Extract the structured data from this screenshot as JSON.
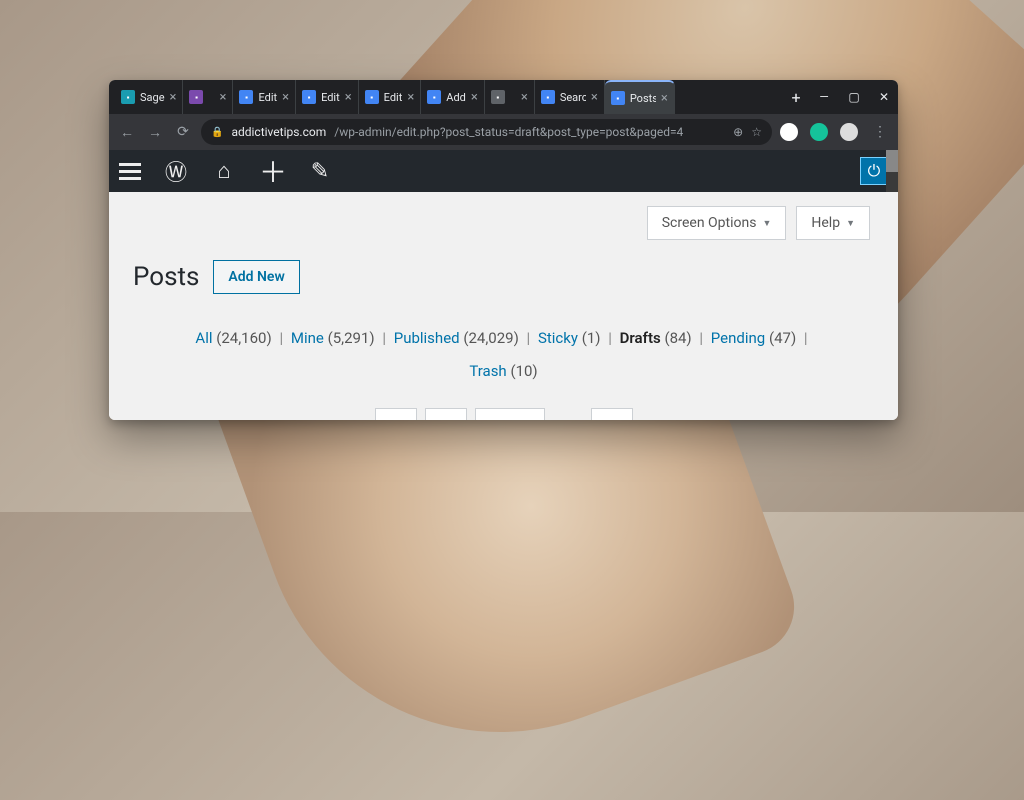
{
  "window": {
    "minimize": "—",
    "maximize": "▢",
    "close": "✕"
  },
  "tabs": [
    {
      "label": "Sage",
      "favicon": "fav-teal"
    },
    {
      "label": "",
      "favicon": "fav-purple"
    },
    {
      "label": "Edit",
      "favicon": "fav-blue"
    },
    {
      "label": "Edit",
      "favicon": "fav-blue"
    },
    {
      "label": "Edit",
      "favicon": "fav-blue"
    },
    {
      "label": "Add",
      "favicon": "fav-blue"
    },
    {
      "label": "",
      "favicon": "fav-grey"
    },
    {
      "label": "Searc",
      "favicon": "fav-blue"
    },
    {
      "label": "Posts",
      "favicon": "fav-blue",
      "active": true
    }
  ],
  "newtab": "+",
  "address": {
    "domain": "addictivetips.com",
    "path": "/wp-admin/edit.php?post_status=draft&post_type=post&paged=4"
  },
  "omni_icons": {
    "lock": "🔒",
    "reader": "⊕",
    "star": "☆"
  },
  "toolbar": {
    "back": "←",
    "forward": "→",
    "reload": "⟳"
  },
  "wordpress_bar": {
    "menu": "menu",
    "logo": "Ⓦ",
    "home": "⌂",
    "new": "＋",
    "edit": "✎",
    "power": "⏻"
  },
  "screen_options_label": "Screen Options",
  "help_label": "Help",
  "page_title": "Posts",
  "add_new_label": "Add New",
  "filters": {
    "all": {
      "label": "All",
      "count": "(24,160)"
    },
    "mine": {
      "label": "Mine",
      "count": "(5,291)"
    },
    "published": {
      "label": "Published",
      "count": "(24,029)"
    },
    "sticky": {
      "label": "Sticky",
      "count": "(1)"
    },
    "drafts": {
      "label": "Drafts",
      "count": "(84)"
    },
    "pending": {
      "label": "Pending",
      "count": "(47)"
    },
    "trash": {
      "label": "Trash",
      "count": "(10)"
    }
  },
  "separator": "|"
}
